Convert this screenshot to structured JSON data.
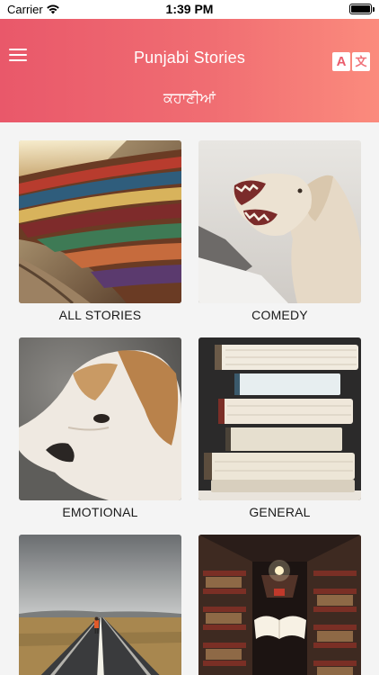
{
  "status_bar": {
    "carrier": "Carrier",
    "time": "1:39 PM"
  },
  "header": {
    "title": "Punjabi Stories",
    "subtitle": "ਕਹਾਣੀਆਂ",
    "translate_icon_letter": "A",
    "translate_icon_glyph": "文",
    "gradient_start": "#e9586a",
    "gradient_end": "#fb8b7d"
  },
  "categories": [
    {
      "label": "ALL STORIES",
      "image": "library-shelves-image"
    },
    {
      "label": "COMEDY",
      "image": "laughing-horse-image"
    },
    {
      "label": "EMOTIONAL",
      "image": "sad-dog-image"
    },
    {
      "label": "GENERAL",
      "image": "book-stack-image"
    },
    {
      "label": "",
      "image": "road-runner-image"
    },
    {
      "label": "",
      "image": "flying-book-library-image"
    }
  ]
}
